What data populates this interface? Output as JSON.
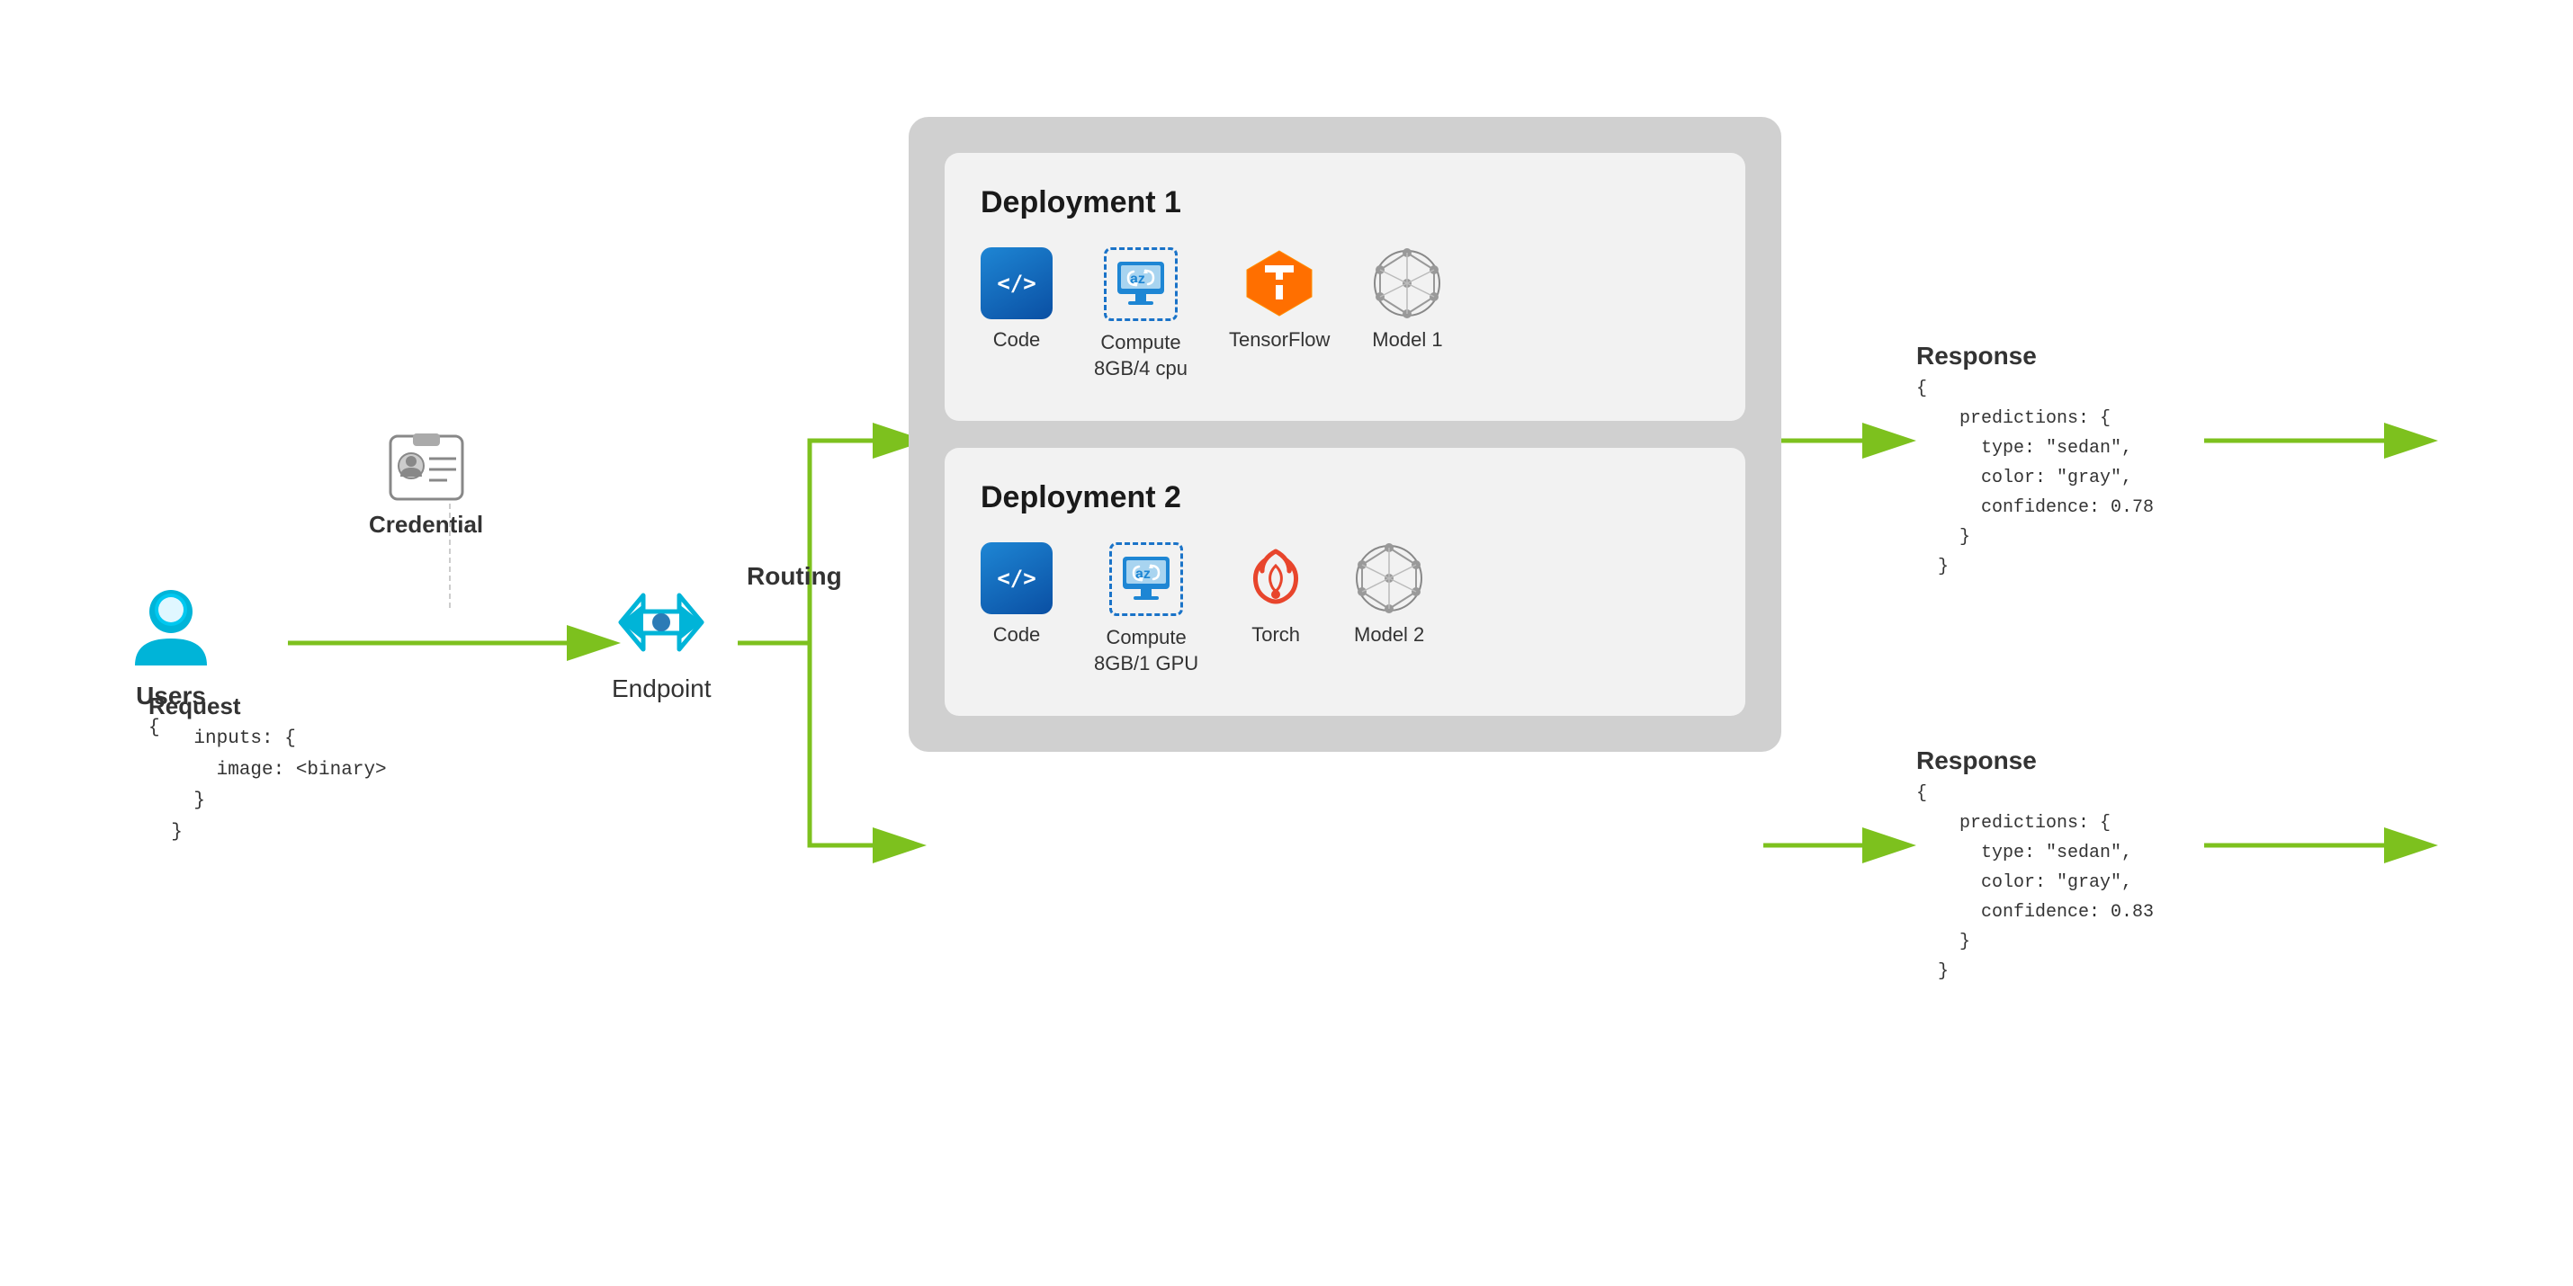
{
  "diagram": {
    "users": {
      "label": "Users",
      "icon_color": "#00b4d8"
    },
    "credential": {
      "label": "Credential"
    },
    "request": {
      "title": "Request",
      "code": "{\n    inputs: {\n      image: <binary>\n    }\n  }"
    },
    "endpoint": {
      "label": "Endpoint",
      "routing_label": "Routing"
    },
    "deployments": [
      {
        "title": "Deployment 1",
        "items": [
          {
            "type": "code",
            "label": "Code"
          },
          {
            "type": "compute",
            "label": "Compute\n8GB/4 cpu"
          },
          {
            "type": "tensorflow",
            "label": "TensorFlow"
          },
          {
            "type": "model",
            "label": "Model 1"
          }
        ],
        "response": {
          "title": "Response",
          "code": "{\n    predictions: {\n      type: \"sedan\",\n      color: \"gray\",\n      confidence: 0.78\n    }\n  }"
        }
      },
      {
        "title": "Deployment 2",
        "items": [
          {
            "type": "code",
            "label": "Code"
          },
          {
            "type": "compute",
            "label": "Compute\n8GB/1 GPU"
          },
          {
            "type": "torch",
            "label": "Torch"
          },
          {
            "type": "model",
            "label": "Model 2"
          }
        ],
        "response": {
          "title": "Response",
          "code": "{\n    predictions: {\n      type: \"sedan\",\n      color: \"gray\",\n      confidence: 0.83\n    }\n  }"
        }
      }
    ]
  }
}
